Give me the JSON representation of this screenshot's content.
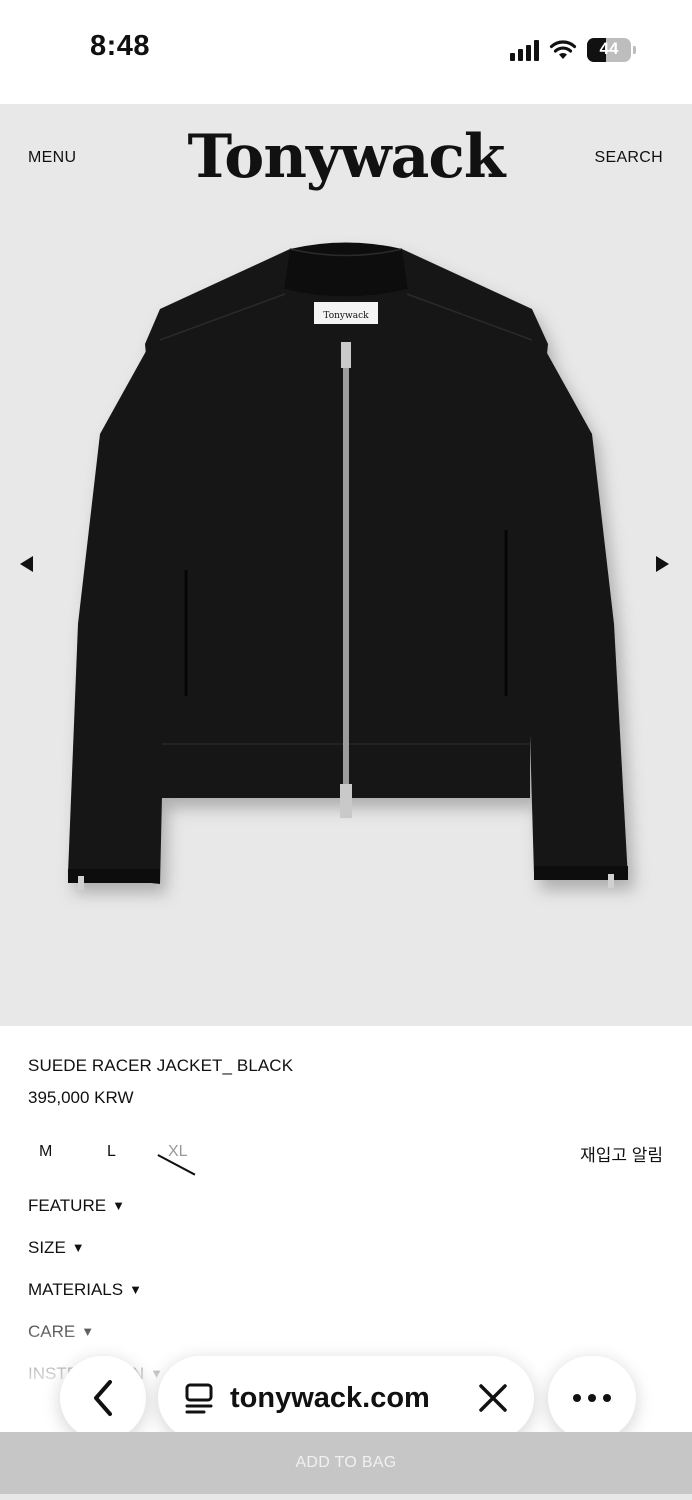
{
  "status": {
    "time": "8:48",
    "battery": "44",
    "battery_fraction": 0.44
  },
  "header": {
    "menu": "MENU",
    "logo": "Tonywack",
    "search": "SEARCH"
  },
  "gallery": {
    "label_text": "Tonywack"
  },
  "product": {
    "name": "SUEDE RACER JACKET_ BLACK",
    "price": "395,000 KRW",
    "sizes": [
      "M",
      "L",
      "XL"
    ],
    "restock_alert": "재입고 알림",
    "sections": [
      "FEATURE",
      "SIZE",
      "MATERIALS",
      "CARE",
      "INSTRUCTION"
    ],
    "caret": "▼"
  },
  "browser": {
    "url": "tonywack.com"
  },
  "cart": {
    "add_to_bag": "ADD TO BAG"
  },
  "colors": {
    "hero_bg": "#e8e8e8",
    "jacket": "#141414",
    "add_bag_bg": "#c6c6c6"
  }
}
